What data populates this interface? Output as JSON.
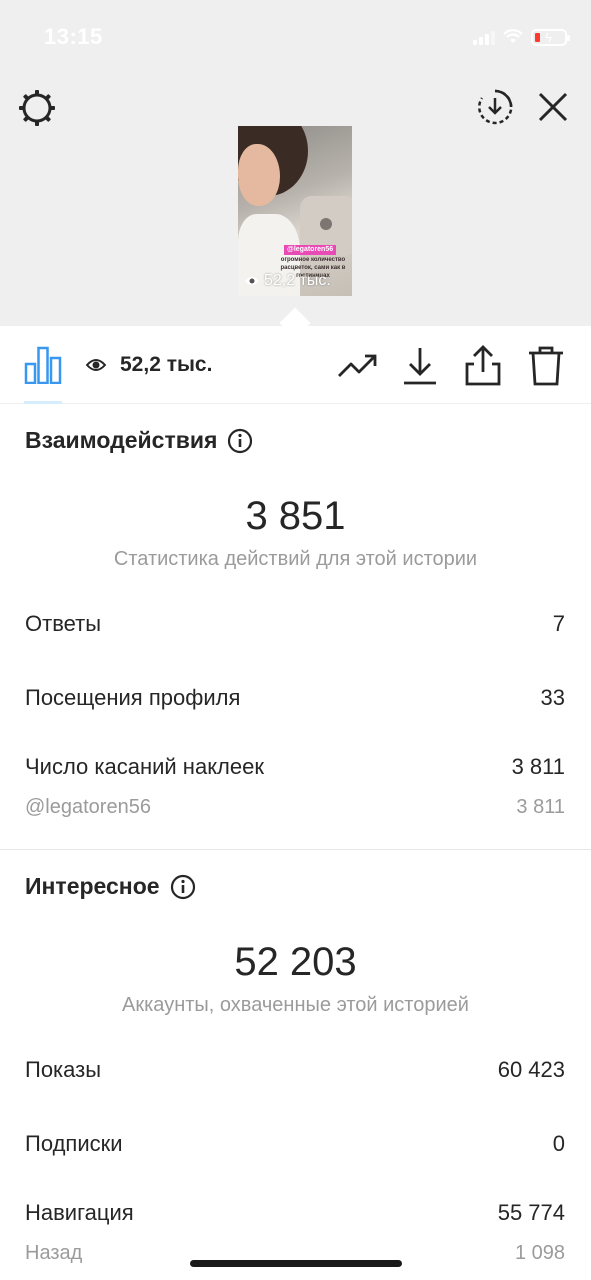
{
  "status_bar": {
    "time": "13:15"
  },
  "preview": {
    "views_overlay": "52,2 тыс.",
    "sticker_mention": "@legatoren56",
    "sticker_text": "огромное количество расцветок, сами как в гостиницах"
  },
  "toolbar": {
    "views": "52,2 тыс."
  },
  "interactions": {
    "title": "Взаимодействия",
    "total": "3 851",
    "caption": "Статистика действий для этой истории",
    "rows": [
      {
        "label": "Ответы",
        "value": "7"
      },
      {
        "label": "Посещения профиля",
        "value": "33"
      },
      {
        "label": "Число касаний наклеек",
        "value": "3 811"
      }
    ],
    "sub_rows": [
      {
        "label": "@legatoren56",
        "value": "3 811"
      }
    ]
  },
  "discovery": {
    "title": "Интересное",
    "total": "52 203",
    "caption": "Аккаунты, охваченные этой историей",
    "rows": [
      {
        "label": "Показы",
        "value": "60 423"
      },
      {
        "label": "Подписки",
        "value": "0"
      },
      {
        "label": "Навигация",
        "value": "55 774"
      }
    ],
    "sub_rows": [
      {
        "label": "Назад",
        "value": "1 098"
      }
    ]
  },
  "colors": {
    "top_background": "#efefef",
    "accent_blue": "#3897f0",
    "muted_text": "#9b9b9b",
    "primary_text": "#262626"
  }
}
